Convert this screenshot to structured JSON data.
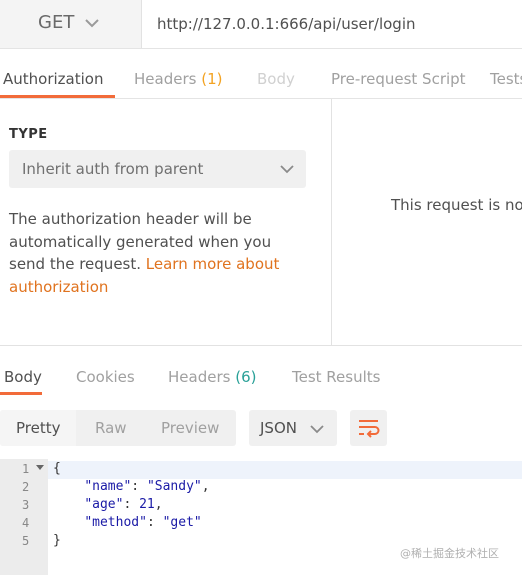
{
  "request": {
    "method": "GET",
    "url": "http://127.0.0.1:666/api/user/login"
  },
  "request_tabs": {
    "authorization": "Authorization",
    "headers": "Headers",
    "headers_count": "(1)",
    "body": "Body",
    "prerequest": "Pre-request Script",
    "tests": "Tests"
  },
  "auth": {
    "type_label": "TYPE",
    "type_value": "Inherit auth from parent",
    "description": "The authorization header will be automatically generated when you send the request.",
    "learn_more": "Learn more about authorization",
    "right_message": "This request is not"
  },
  "response_tabs": {
    "body": "Body",
    "cookies": "Cookies",
    "headers": "Headers",
    "headers_count": "(6)",
    "test_results": "Test Results"
  },
  "view": {
    "pretty": "Pretty",
    "raw": "Raw",
    "preview": "Preview",
    "format": "JSON"
  },
  "code": {
    "line_numbers": [
      "1",
      "2",
      "3",
      "4",
      "5"
    ],
    "open_brace": "{",
    "close_brace": "}",
    "name_key": "\"name\"",
    "name_value": "\"Sandy\"",
    "age_key": "\"age\"",
    "age_value": "21",
    "method_key": "\"method\"",
    "method_value": "\"get\""
  },
  "watermark": "@稀土掘金技术社区",
  "colors": {
    "accent": "#f26b3a",
    "link": "#e0731f",
    "request_count": "#f3a323",
    "response_count": "#2aa198"
  },
  "icons": {
    "method_dropdown": "chevron-down-icon",
    "auth_dropdown": "chevron-down-icon",
    "format_dropdown": "chevron-down-icon",
    "wrap": "wrap-lines-icon",
    "fold": "fold-arrow-icon"
  }
}
